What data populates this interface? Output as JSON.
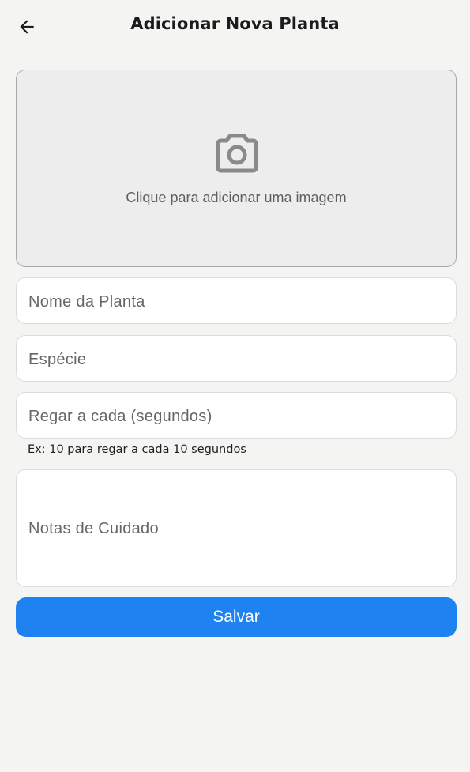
{
  "header": {
    "title": "Adicionar Nova Planta",
    "back_icon": "arrow-left-icon"
  },
  "image_picker": {
    "icon": "camera-icon",
    "label": "Clique para adicionar uma imagem"
  },
  "form": {
    "plant_name_placeholder": "Nome da Planta",
    "species_placeholder": "Espécie",
    "watering_placeholder": "Regar a cada (segundos)",
    "watering_helper": "Ex: 10 para regar a cada 10 segundos",
    "care_notes_placeholder": "Notas de Cuidado"
  },
  "actions": {
    "save_label": "Salvar"
  },
  "colors": {
    "background": "#f4f5f3",
    "primary": "#1e82f0",
    "picker_bg": "#ededed",
    "icon_gray": "#8a8a8a"
  }
}
